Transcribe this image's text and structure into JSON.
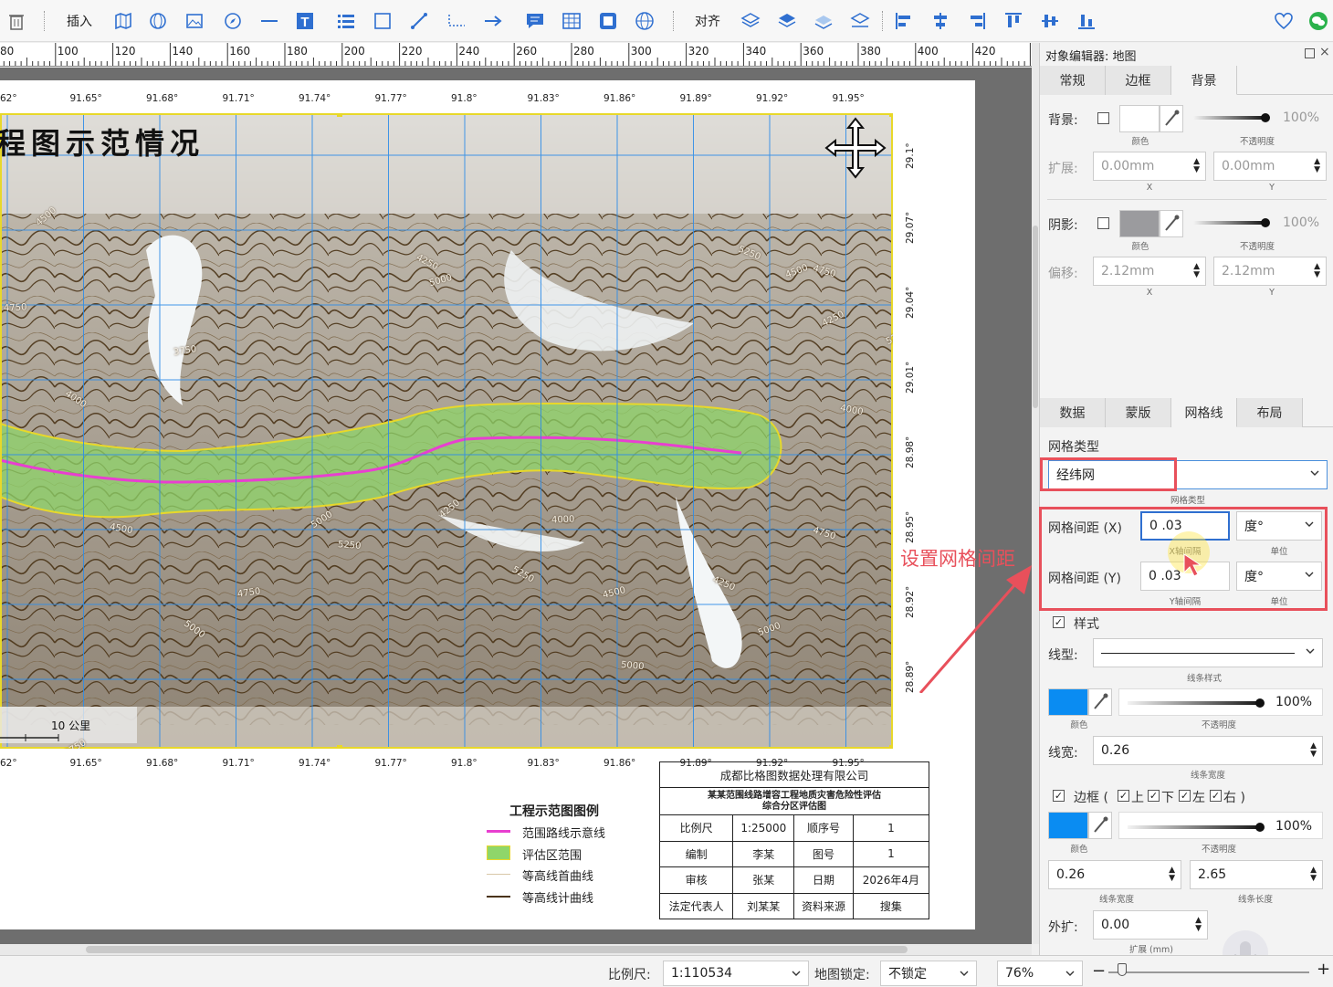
{
  "toolbar": {
    "insert_label": "插入",
    "align_label": "对齐",
    "icons": [
      "trash-icon",
      "map-icon",
      "globe-icon",
      "image-icon",
      "compass-icon",
      "line-icon",
      "text-icon",
      "list-icon",
      "rectangle-icon",
      "pen-icon",
      "dotted-line-icon",
      "arrow-icon",
      "comment-icon",
      "table-icon",
      "frame-icon",
      "earth-icon",
      "layer-up-icon",
      "layer-down-icon",
      "layer-top-icon",
      "layer-bottom-icon",
      "align-left-icon",
      "align-center-icon",
      "align-right-icon",
      "align-top-icon",
      "align-middle-icon",
      "align-bottom-icon",
      "heart-icon",
      "wechat-icon"
    ]
  },
  "ruler": {
    "labels": [
      "80",
      "100",
      "120",
      "140",
      "160",
      "180",
      "200",
      "220",
      "240",
      "260",
      "280",
      "300",
      "320",
      "340",
      "360",
      "380",
      "400",
      "420"
    ]
  },
  "map": {
    "title": "程图示范情况",
    "top_lon": [
      "62°",
      "91.65°",
      "91.68°",
      "91.71°",
      "91.74°",
      "91.77°",
      "91.8°",
      "91.83°",
      "91.86°",
      "91.89°",
      "91.92°",
      "91.95°"
    ],
    "bottom_lon": [
      "62°",
      "91.65°",
      "91.68°",
      "91.71°",
      "91.74°",
      "91.77°",
      "91.8°",
      "91.83°",
      "91.86°",
      "91.89°",
      "91.92°",
      "91.95°"
    ],
    "right_lat": [
      "29.1°",
      "29.07°",
      "29.04°",
      "29.01°",
      "28.98°",
      "28.95°",
      "28.92°",
      "28.89°"
    ],
    "scale_text": "10 公里",
    "contour_labels": [
      "4500",
      "4750",
      "4000",
      "3750",
      "4250",
      "5000",
      "5250",
      "4500",
      "4750",
      "4250",
      "4500",
      "5000",
      "5250",
      "4250",
      "4000",
      "5000",
      "4750",
      "5250",
      "4500",
      "4250",
      "5000",
      "4750",
      "5250",
      "4000",
      "3750",
      "5000"
    ],
    "annotation": "设置网格间距",
    "colors": {
      "grid": "#2f8de8",
      "route": "#e83fd0",
      "zone": "#8fd66a",
      "frame": "#e8d82a",
      "arrow": "#e8505b"
    }
  },
  "legend": {
    "title": "工程示范图图例",
    "items": [
      "范围路线示意线",
      "评估区范围",
      "等高线首曲线",
      "等高线计曲线"
    ]
  },
  "info": {
    "company": "成都比格图数据处理有限公司",
    "project": "某某范围线路增容工程地质灾害危险性评估",
    "project2": "综合分区评估图",
    "rows": [
      [
        "比例尺",
        "1:25000",
        "顺序号",
        "1"
      ],
      [
        "编制",
        "李某",
        "图号",
        "1"
      ],
      [
        "审核",
        "张某",
        "日期",
        "2026年4月"
      ],
      [
        "法定代表人",
        "刘某某",
        "资料来源",
        "搜集"
      ]
    ]
  },
  "panel": {
    "title": "对象编辑器: 地图",
    "tabs_top": [
      "常规",
      "边框",
      "背景"
    ],
    "active_top": "背景",
    "background": {
      "bg_label": "背景:",
      "color_sub": "颜色",
      "opacity_sub": "不透明度",
      "opacity": "100%",
      "expand_label": "扩展:",
      "expand_x": "0.00mm",
      "expand_y": "0.00mm",
      "x_sub": "X",
      "y_sub": "Y",
      "shadow_label": "阴影:",
      "shadow_opacity": "100%",
      "offset_label": "偏移:",
      "offset_x": "2.12mm",
      "offset_y": "2.12mm"
    },
    "tabs_bottom": [
      "数据",
      "蒙版",
      "网格线",
      "布局"
    ],
    "active_bottom": "网格线",
    "grid": {
      "type_label": "网格类型",
      "type_value": "经纬网",
      "type_sub": "网格类型",
      "x_label": "网格间距 (X)",
      "x_value": "0 .03",
      "x_sub": "X轴间隔",
      "x_unit": "度°",
      "unit_sub": "单位",
      "y_label": "网格间距 (Y)",
      "y_value": "0 .03",
      "y_sub": "Y轴间隔",
      "y_unit": "度°",
      "style_label": "样式",
      "linetype_label": "线型:",
      "linetype_sub": "线条样式",
      "color_sub": "颜色",
      "opacity": "100%",
      "opacity_sub": "不透明度",
      "linewidth_label": "线宽:",
      "linewidth": "0.26",
      "linewidth_sub": "线条宽度",
      "border_label": "边框 (",
      "border_top": "上",
      "border_bottom": "下",
      "border_left": "左",
      "border_right": "右 )",
      "border_opacity": "100%",
      "border_width": "0.26",
      "border_length": "2.65",
      "border_width_sub": "线条宽度",
      "border_length_sub": "线条长度",
      "outer_label": "外扩:",
      "outer_value": "0.00",
      "outer_sub": "扩展 (mm)"
    }
  },
  "status": {
    "scale_label": "比例尺:",
    "scale_value": "1:110534",
    "lock_label": "地图锁定:",
    "lock_value": "不锁定",
    "zoom_value": "76%"
  }
}
